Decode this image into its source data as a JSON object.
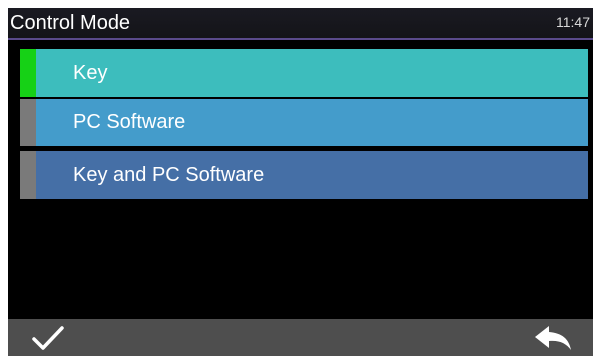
{
  "header": {
    "title": "Control Mode",
    "time": "11:47"
  },
  "options": [
    {
      "label": "Key",
      "color": "#3dbdbd",
      "indicator_color": "#16d116",
      "selected": true
    },
    {
      "label": "PC Software",
      "color": "#449ccb",
      "indicator_color": "#7a7a7a",
      "selected": false
    },
    {
      "label": "Key and PC Software",
      "color": "#456fa6",
      "indicator_color": "#7a7a7a",
      "selected": false
    }
  ],
  "footer": {
    "confirm_icon": "checkmark-icon",
    "back_icon": "back-arrow-icon",
    "bar_color": "#4e4e4e"
  }
}
